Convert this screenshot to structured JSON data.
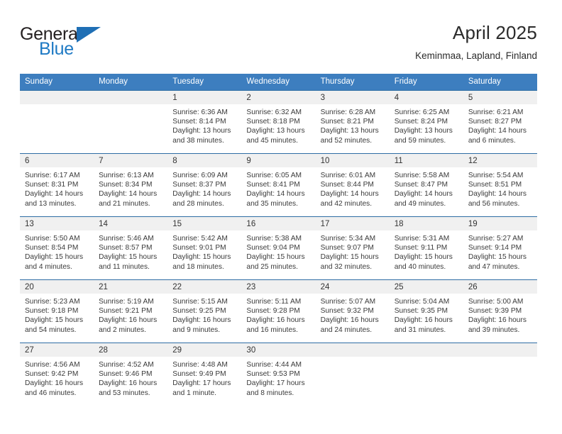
{
  "brand": {
    "name_part1": "General",
    "name_part2": "Blue",
    "flag_icon": "triangle-flag-icon",
    "accent_color": "#1f7ac4"
  },
  "header": {
    "title": "April 2025",
    "subtitle": "Keminmaa, Lapland, Finland"
  },
  "theme": {
    "header_bg": "#3d7ebf",
    "row_border": "#2e6da4",
    "daynum_band_bg": "#f0f0f0",
    "text": "#3a3a3a"
  },
  "labels": {
    "sunrise_prefix": "Sunrise:",
    "sunset_prefix": "Sunset:",
    "daylight_prefix": "Daylight:"
  },
  "calendar": {
    "weekday_headers": [
      "Sunday",
      "Monday",
      "Tuesday",
      "Wednesday",
      "Thursday",
      "Friday",
      "Saturday"
    ],
    "weeks": [
      [
        {
          "day": ""
        },
        {
          "day": ""
        },
        {
          "day": "1",
          "sunrise": "Sunrise: 6:36 AM",
          "sunset": "Sunset: 8:14 PM",
          "daylight": "Daylight: 13 hours and 38 minutes."
        },
        {
          "day": "2",
          "sunrise": "Sunrise: 6:32 AM",
          "sunset": "Sunset: 8:18 PM",
          "daylight": "Daylight: 13 hours and 45 minutes."
        },
        {
          "day": "3",
          "sunrise": "Sunrise: 6:28 AM",
          "sunset": "Sunset: 8:21 PM",
          "daylight": "Daylight: 13 hours and 52 minutes."
        },
        {
          "day": "4",
          "sunrise": "Sunrise: 6:25 AM",
          "sunset": "Sunset: 8:24 PM",
          "daylight": "Daylight: 13 hours and 59 minutes."
        },
        {
          "day": "5",
          "sunrise": "Sunrise: 6:21 AM",
          "sunset": "Sunset: 8:27 PM",
          "daylight": "Daylight: 14 hours and 6 minutes."
        }
      ],
      [
        {
          "day": "6",
          "sunrise": "Sunrise: 6:17 AM",
          "sunset": "Sunset: 8:31 PM",
          "daylight": "Daylight: 14 hours and 13 minutes."
        },
        {
          "day": "7",
          "sunrise": "Sunrise: 6:13 AM",
          "sunset": "Sunset: 8:34 PM",
          "daylight": "Daylight: 14 hours and 21 minutes."
        },
        {
          "day": "8",
          "sunrise": "Sunrise: 6:09 AM",
          "sunset": "Sunset: 8:37 PM",
          "daylight": "Daylight: 14 hours and 28 minutes."
        },
        {
          "day": "9",
          "sunrise": "Sunrise: 6:05 AM",
          "sunset": "Sunset: 8:41 PM",
          "daylight": "Daylight: 14 hours and 35 minutes."
        },
        {
          "day": "10",
          "sunrise": "Sunrise: 6:01 AM",
          "sunset": "Sunset: 8:44 PM",
          "daylight": "Daylight: 14 hours and 42 minutes."
        },
        {
          "day": "11",
          "sunrise": "Sunrise: 5:58 AM",
          "sunset": "Sunset: 8:47 PM",
          "daylight": "Daylight: 14 hours and 49 minutes."
        },
        {
          "day": "12",
          "sunrise": "Sunrise: 5:54 AM",
          "sunset": "Sunset: 8:51 PM",
          "daylight": "Daylight: 14 hours and 56 minutes."
        }
      ],
      [
        {
          "day": "13",
          "sunrise": "Sunrise: 5:50 AM",
          "sunset": "Sunset: 8:54 PM",
          "daylight": "Daylight: 15 hours and 4 minutes."
        },
        {
          "day": "14",
          "sunrise": "Sunrise: 5:46 AM",
          "sunset": "Sunset: 8:57 PM",
          "daylight": "Daylight: 15 hours and 11 minutes."
        },
        {
          "day": "15",
          "sunrise": "Sunrise: 5:42 AM",
          "sunset": "Sunset: 9:01 PM",
          "daylight": "Daylight: 15 hours and 18 minutes."
        },
        {
          "day": "16",
          "sunrise": "Sunrise: 5:38 AM",
          "sunset": "Sunset: 9:04 PM",
          "daylight": "Daylight: 15 hours and 25 minutes."
        },
        {
          "day": "17",
          "sunrise": "Sunrise: 5:34 AM",
          "sunset": "Sunset: 9:07 PM",
          "daylight": "Daylight: 15 hours and 32 minutes."
        },
        {
          "day": "18",
          "sunrise": "Sunrise: 5:31 AM",
          "sunset": "Sunset: 9:11 PM",
          "daylight": "Daylight: 15 hours and 40 minutes."
        },
        {
          "day": "19",
          "sunrise": "Sunrise: 5:27 AM",
          "sunset": "Sunset: 9:14 PM",
          "daylight": "Daylight: 15 hours and 47 minutes."
        }
      ],
      [
        {
          "day": "20",
          "sunrise": "Sunrise: 5:23 AM",
          "sunset": "Sunset: 9:18 PM",
          "daylight": "Daylight: 15 hours and 54 minutes."
        },
        {
          "day": "21",
          "sunrise": "Sunrise: 5:19 AM",
          "sunset": "Sunset: 9:21 PM",
          "daylight": "Daylight: 16 hours and 2 minutes."
        },
        {
          "day": "22",
          "sunrise": "Sunrise: 5:15 AM",
          "sunset": "Sunset: 9:25 PM",
          "daylight": "Daylight: 16 hours and 9 minutes."
        },
        {
          "day": "23",
          "sunrise": "Sunrise: 5:11 AM",
          "sunset": "Sunset: 9:28 PM",
          "daylight": "Daylight: 16 hours and 16 minutes."
        },
        {
          "day": "24",
          "sunrise": "Sunrise: 5:07 AM",
          "sunset": "Sunset: 9:32 PM",
          "daylight": "Daylight: 16 hours and 24 minutes."
        },
        {
          "day": "25",
          "sunrise": "Sunrise: 5:04 AM",
          "sunset": "Sunset: 9:35 PM",
          "daylight": "Daylight: 16 hours and 31 minutes."
        },
        {
          "day": "26",
          "sunrise": "Sunrise: 5:00 AM",
          "sunset": "Sunset: 9:39 PM",
          "daylight": "Daylight: 16 hours and 39 minutes."
        }
      ],
      [
        {
          "day": "27",
          "sunrise": "Sunrise: 4:56 AM",
          "sunset": "Sunset: 9:42 PM",
          "daylight": "Daylight: 16 hours and 46 minutes."
        },
        {
          "day": "28",
          "sunrise": "Sunrise: 4:52 AM",
          "sunset": "Sunset: 9:46 PM",
          "daylight": "Daylight: 16 hours and 53 minutes."
        },
        {
          "day": "29",
          "sunrise": "Sunrise: 4:48 AM",
          "sunset": "Sunset: 9:49 PM",
          "daylight": "Daylight: 17 hours and 1 minute."
        },
        {
          "day": "30",
          "sunrise": "Sunrise: 4:44 AM",
          "sunset": "Sunset: 9:53 PM",
          "daylight": "Daylight: 17 hours and 8 minutes."
        },
        {
          "day": ""
        },
        {
          "day": ""
        },
        {
          "day": ""
        }
      ]
    ]
  }
}
